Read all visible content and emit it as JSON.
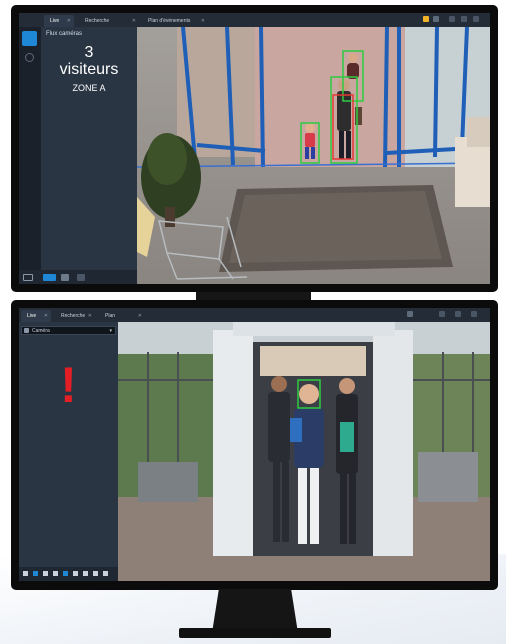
{
  "monitor_top": {
    "tabs": [
      {
        "label": "Live",
        "active": true
      },
      {
        "label": "Recherche",
        "active": false
      },
      {
        "label": "Plan d'événements",
        "active": false
      }
    ],
    "panel_title": "Flux caméras",
    "visitor_count": "3",
    "visitor_label": "visiteurs",
    "zone_label": "ZONE A",
    "rail_icons": [
      "camera-grid-icon",
      "settings-icon"
    ],
    "accent_color": "#1e88d6",
    "detection_box_colors": [
      "#2ecc40",
      "#e53935"
    ]
  },
  "monitor_bottom": {
    "tabs": [
      {
        "label": "Live",
        "active": true
      },
      {
        "label": "Recherche",
        "active": false
      },
      {
        "label": "Plan d'événements",
        "active": false
      }
    ],
    "camera_select": {
      "value": "Caméra"
    },
    "alert_symbol": "!",
    "alert_color": "#e31e24",
    "detection_box_color": "#2ecc40"
  }
}
